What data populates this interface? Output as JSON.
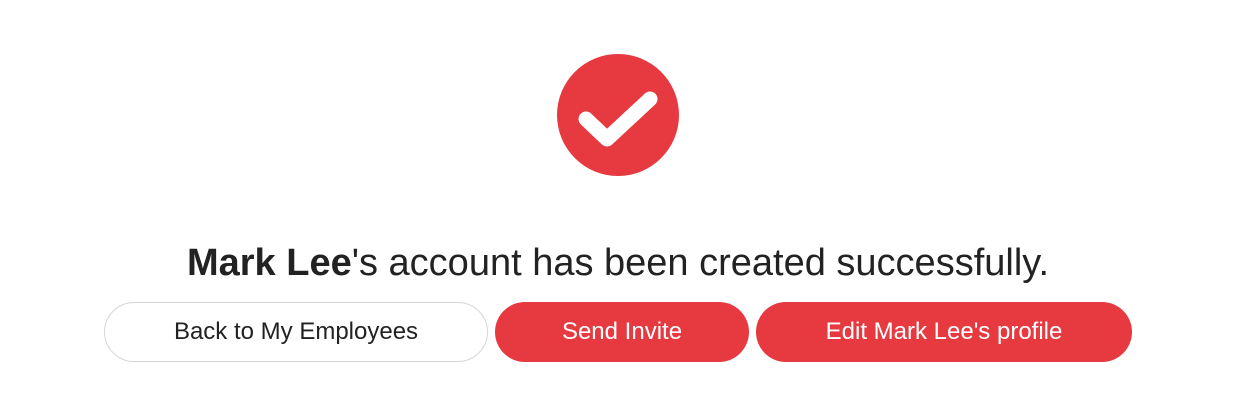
{
  "status": {
    "icon": "checkmark-circle-icon",
    "color": "#e63940"
  },
  "message": {
    "name": "Mark Lee",
    "text": "'s account has been created successfully."
  },
  "actions": {
    "back_label": "Back to My Employees",
    "invite_label": "Send Invite",
    "edit_label": "Edit Mark Lee's profile"
  },
  "colors": {
    "accent": "#e63940",
    "text": "#222222",
    "outline_border": "#d6d6d6"
  }
}
